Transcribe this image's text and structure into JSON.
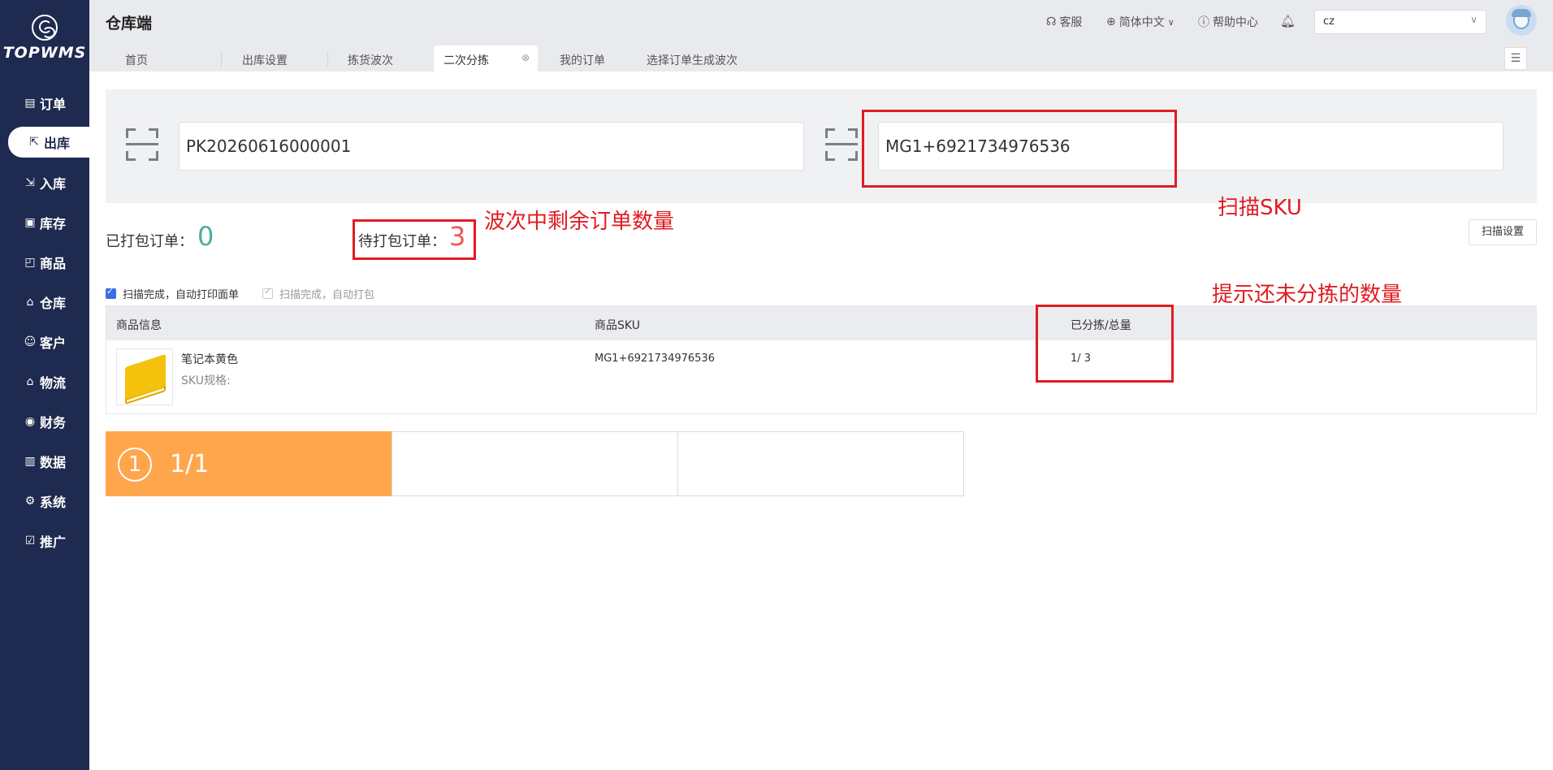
{
  "brand": {
    "name": "TOPWMS"
  },
  "sidebar": {
    "items": [
      {
        "label": "订单",
        "icon": "list-icon"
      },
      {
        "label": "出库",
        "icon": "outbound-icon",
        "active": true
      },
      {
        "label": "入库",
        "icon": "inbound-icon"
      },
      {
        "label": "库存",
        "icon": "inventory-icon"
      },
      {
        "label": "商品",
        "icon": "bag-icon"
      },
      {
        "label": "仓库",
        "icon": "warehouse-icon"
      },
      {
        "label": "客户",
        "icon": "user-icon"
      },
      {
        "label": "物流",
        "icon": "truck-icon"
      },
      {
        "label": "财务",
        "icon": "finance-icon"
      },
      {
        "label": "数据",
        "icon": "chart-icon"
      },
      {
        "label": "系统",
        "icon": "gear-icon"
      },
      {
        "label": "推广",
        "icon": "promo-icon"
      }
    ]
  },
  "header": {
    "title": "仓库端",
    "service": "客服",
    "language": "简体中文",
    "help": "帮助中心",
    "user_select_value": "cz"
  },
  "tabs": [
    {
      "label": "首页"
    },
    {
      "label": "出库设置"
    },
    {
      "label": "拣货波次"
    },
    {
      "label": "二次分拣",
      "active": true
    },
    {
      "label": "我的订单"
    },
    {
      "label": "选择订单生成波次"
    }
  ],
  "scan": {
    "wave_input_value": "PK20260616000001",
    "sku_input_value": "MG1+6921734976536"
  },
  "stats": {
    "packed_label": "已打包订单：",
    "packed_value": "0",
    "pending_label": "待打包订单：",
    "pending_value": "3"
  },
  "scan_settings_button": "扫描设置",
  "options": {
    "auto_print_label": "扫描完成，自动打印面单",
    "auto_pack_label": "扫描完成，自动打包"
  },
  "table": {
    "headers": [
      "商品信息",
      "商品SKU",
      "已分拣/总量"
    ],
    "rows": [
      {
        "name": "笔记本黄色",
        "spec": "SKU规格:",
        "sku": "MG1+6921734976536",
        "progress": "1/ 3"
      }
    ]
  },
  "slots": [
    {
      "index": "1",
      "count": "1/1",
      "highlighted": true
    },
    {
      "index": "",
      "count": ""
    },
    {
      "index": "",
      "count": ""
    }
  ],
  "annotations": {
    "remaining_orders": "波次中剩余订单数量",
    "scan_sku": "扫描SKU",
    "unsorted_hint": "提示还未分拣的数量"
  },
  "colors": {
    "sidebar_bg": "#1e2a4f",
    "accent_green": "#4cae9a",
    "accent_red": "#f05656",
    "slot_highlight": "#ffa64d",
    "annotation_red": "#e11b22"
  }
}
